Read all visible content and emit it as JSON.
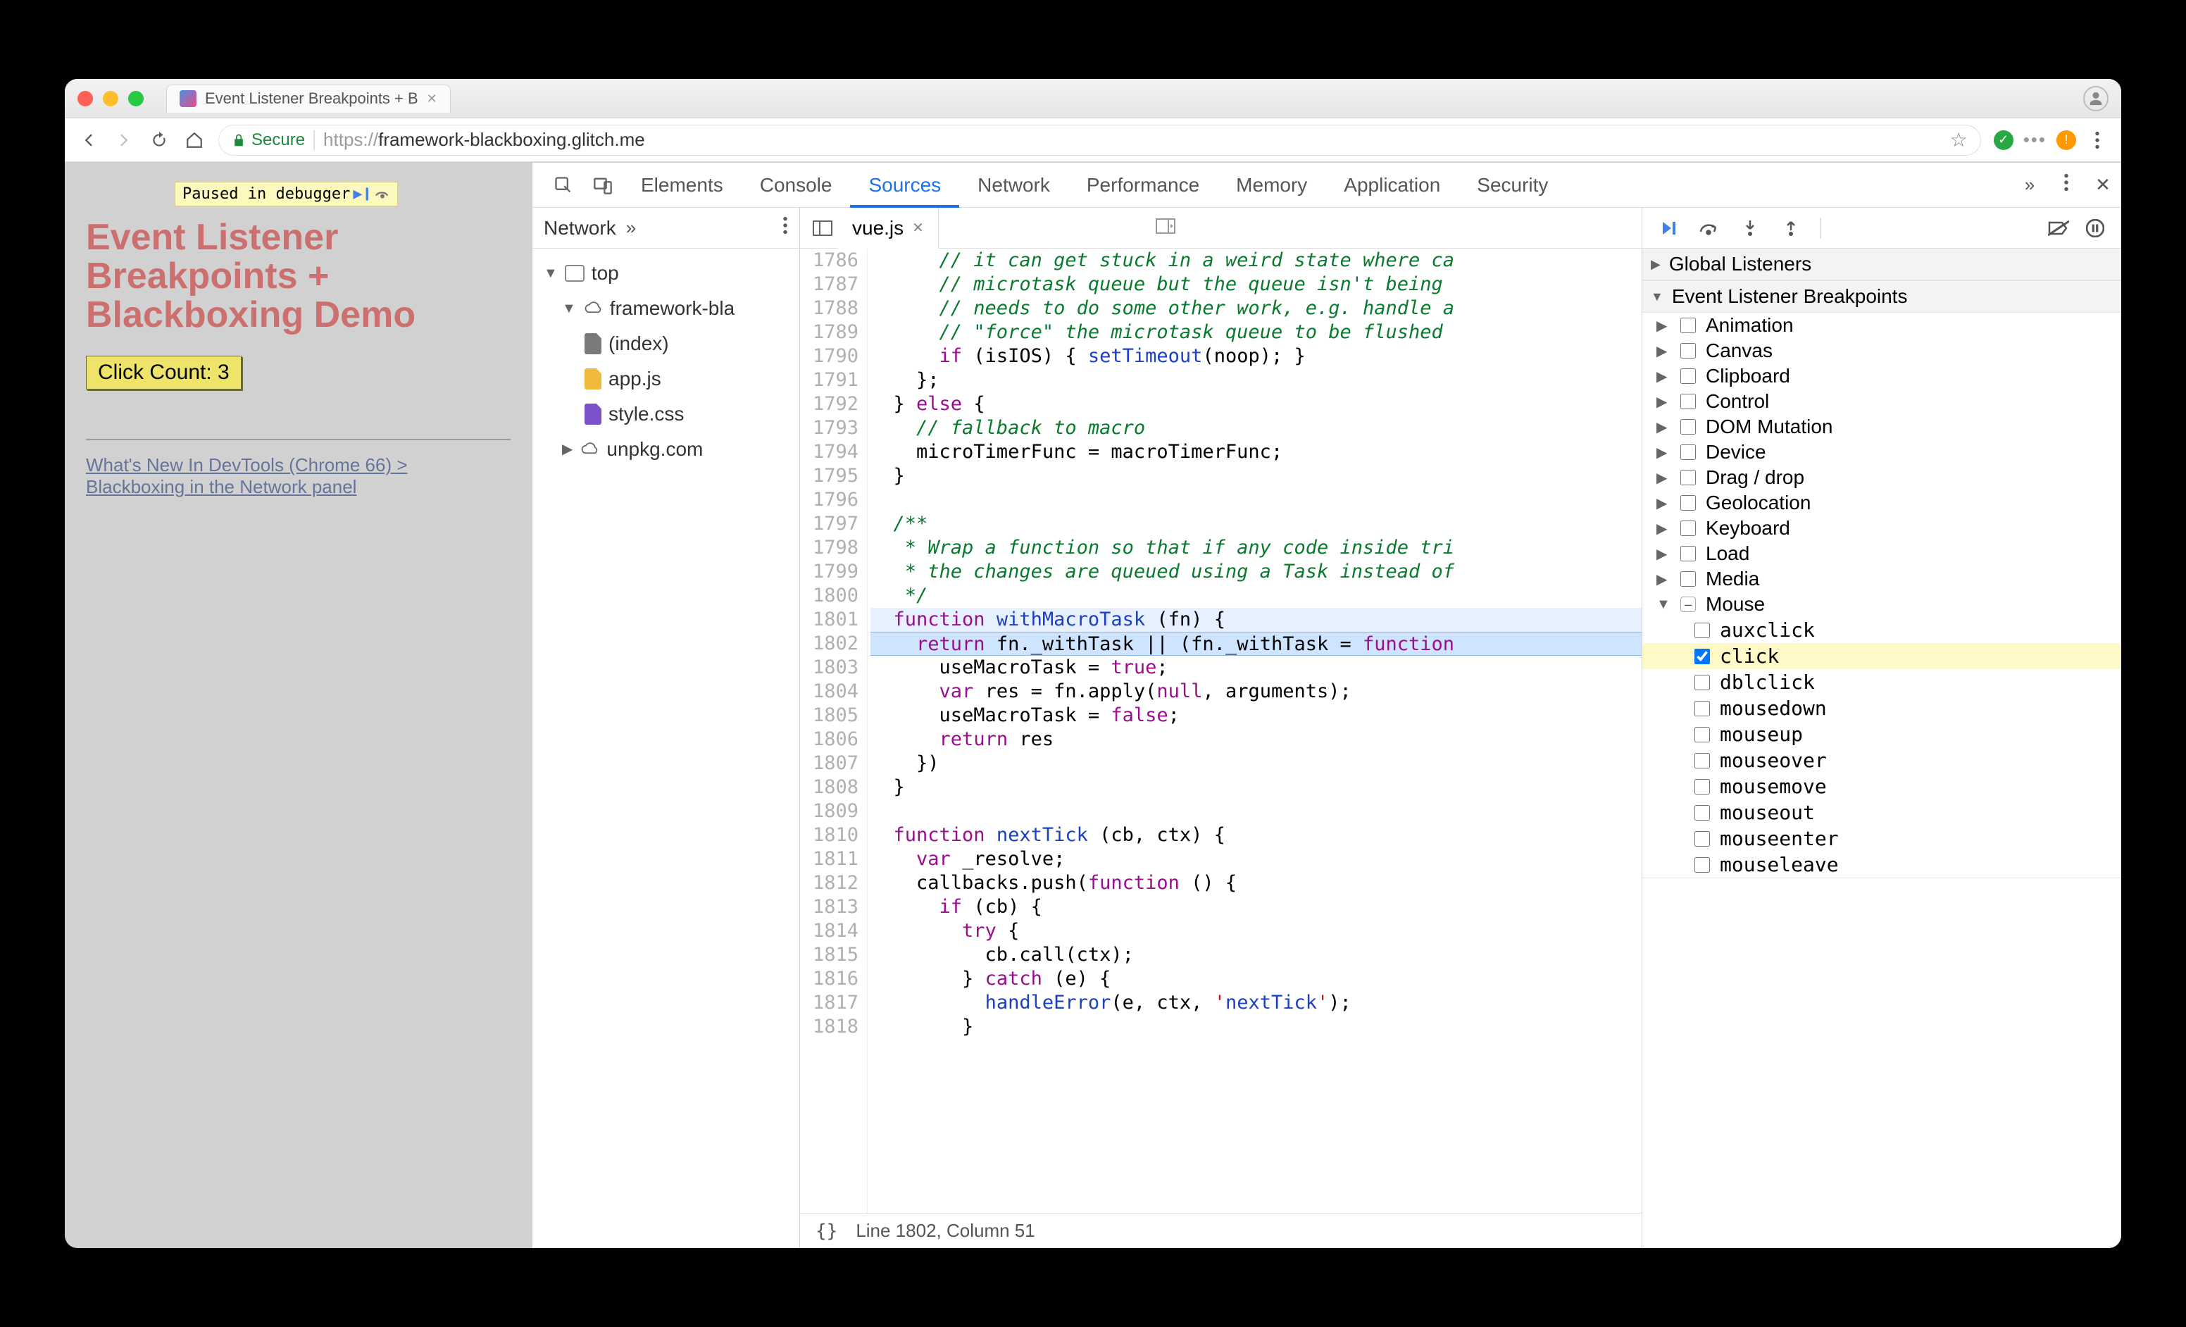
{
  "browser": {
    "tab_title": "Event Listener Breakpoints + B",
    "secure_label": "Secure",
    "url_prefix": "https://",
    "url_host": "framework-blackboxing.glitch.me"
  },
  "page": {
    "paused_label": "Paused in debugger",
    "heading": "Event Listener Breakpoints + Blackboxing Demo",
    "button_label": "Click Count: 3",
    "link_text": "What's New In DevTools (Chrome 66) > Blackboxing in the Network panel"
  },
  "devtools": {
    "tabs": [
      "Elements",
      "Console",
      "Sources",
      "Network",
      "Performance",
      "Memory",
      "Application",
      "Security"
    ],
    "active_tab": "Sources",
    "nav_tab": "Network",
    "tree": {
      "top": "top",
      "origin1": "framework-bla",
      "files": [
        "(index)",
        "app.js",
        "style.css"
      ],
      "origin2": "unpkg.com"
    },
    "editor": {
      "file": "vue.js",
      "line_start": 1786,
      "lines": [
        "      // it can get stuck in a weird state where ca",
        "      // microtask queue but the queue isn't being ",
        "      // needs to do some other work, e.g. handle a",
        "      // \"force\" the microtask queue to be flushed ",
        "      if (isIOS) { setTimeout(noop); }",
        "    };",
        "  } else {",
        "    // fallback to macro",
        "    microTimerFunc = macroTimerFunc;",
        "  }",
        "",
        "  /**",
        "   * Wrap a function so that if any code inside tri",
        "   * the changes are queued using a Task instead of",
        "   */",
        "  function withMacroTask (fn) {",
        "    return fn._withTask || (fn._withTask = function",
        "      useMacroTask = true;",
        "      var res = fn.apply(null, arguments);",
        "      useMacroTask = false;",
        "      return res",
        "    })",
        "  }",
        "",
        "  function nextTick (cb, ctx) {",
        "    var _resolve;",
        "    callbacks.push(function () {",
        "      if (cb) {",
        "        try {",
        "          cb.call(ctx);",
        "        } catch (e) {",
        "          handleError(e, ctx, 'nextTick');",
        "        }"
      ],
      "highlight_line": 1802,
      "exec_line": 1801,
      "status": "Line 1802, Column 51"
    },
    "breakpoints": {
      "global_listeners": "Global Listeners",
      "section_title": "Event Listener Breakpoints",
      "categories": [
        "Animation",
        "Canvas",
        "Clipboard",
        "Control",
        "DOM Mutation",
        "Device",
        "Drag / drop",
        "Geolocation",
        "Keyboard",
        "Load",
        "Media",
        "Mouse"
      ],
      "mouse_events": [
        "auxclick",
        "click",
        "dblclick",
        "mousedown",
        "mouseup",
        "mouseover",
        "mousemove",
        "mouseout",
        "mouseenter",
        "mouseleave"
      ],
      "checked_event": "click"
    }
  }
}
